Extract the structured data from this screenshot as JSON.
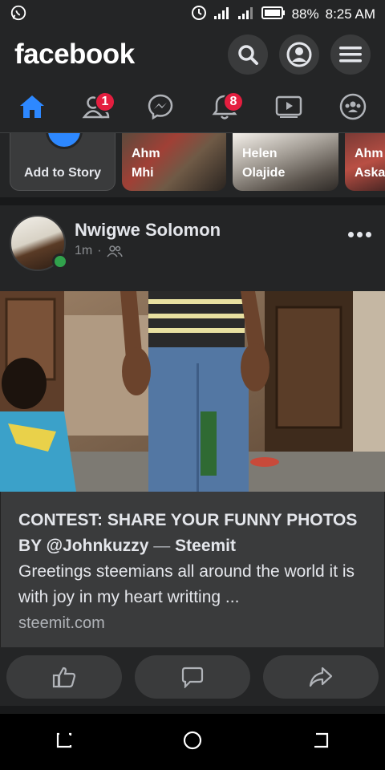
{
  "status_bar": {
    "battery": "88%",
    "time": "8:25 AM"
  },
  "header": {
    "logo": "facebook"
  },
  "tabs": [
    {
      "icon": "home-icon",
      "badge": ""
    },
    {
      "icon": "friends-icon",
      "badge": "1"
    },
    {
      "icon": "messenger-icon",
      "badge": ""
    },
    {
      "icon": "bell-icon",
      "badge": "8"
    },
    {
      "icon": "watch-icon",
      "badge": ""
    },
    {
      "icon": "groups-icon",
      "badge": ""
    }
  ],
  "stories": {
    "add_label": "Add to Story",
    "items": [
      {
        "name_line1": "Ahm",
        "name_line2": "Mhi"
      },
      {
        "name_line1": "Helen",
        "name_line2": "Olajide"
      },
      {
        "name_line1": "Ahm",
        "name_line2": "Aska"
      }
    ]
  },
  "post": {
    "author": "Nwigwe Solomon",
    "time": "1m",
    "separator": "·",
    "link": {
      "title_part": "CONTEST: SHARE YOUR FUNNY PHOTOS BY @Johnkuzzy",
      "dash": "—",
      "source": "Steemit",
      "description": "Greetings steemians all around the world it is with joy in my heart writting ...",
      "domain": "steemit.com"
    }
  },
  "colors": {
    "accent": "#2d88ff",
    "badge": "#e41e3f",
    "online": "#31a24c",
    "surface": "#242526"
  }
}
